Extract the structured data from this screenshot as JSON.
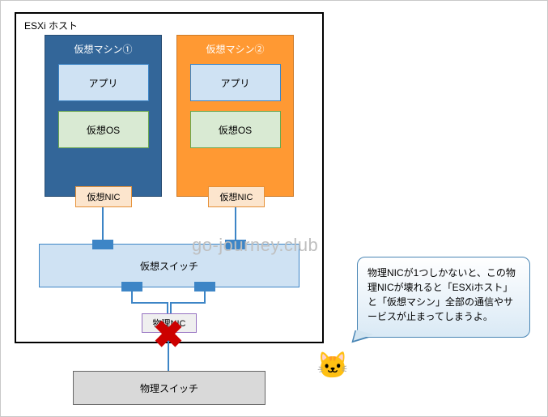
{
  "esxi_host_label": "ESXi ホスト",
  "vm": [
    {
      "title": "仮想マシン①",
      "app": "アプリ",
      "os": "仮想OS",
      "nic": "仮想NIC"
    },
    {
      "title": "仮想マシン②",
      "app": "アプリ",
      "os": "仮想OS",
      "nic": "仮想NIC"
    }
  ],
  "virtual_switch": "仮想スイッチ",
  "physical_nic": "物理NIC",
  "physical_switch": "物理スイッチ",
  "bubble_text": "物理NICが1つしかないと、この物理NICが壊れると「ESXiホスト」と「仮想マシン」全部の通信やサービスが止まってしまうよ。",
  "watermark": "go-journey.club",
  "cat_glyph": "🐱",
  "x_glyph": "✖"
}
